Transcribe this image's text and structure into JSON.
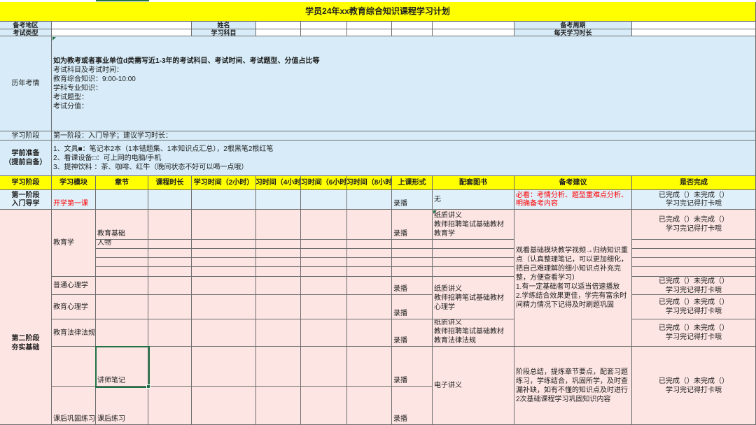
{
  "sheet": {
    "title": "学员24年xx教育综合知识课程学习计划"
  },
  "info": {
    "region_label": "备考地区",
    "name_label": "姓名",
    "period_label": "备考周期",
    "exam_type_label": "考试类型",
    "subject_label": "学习科目",
    "daily_time_label": "每天学习时长"
  },
  "history": {
    "label": "历年考情",
    "note": "如为教考或者事业单位d类需写近1-3年的考试科目、考试时间、考试题型、分值占比等",
    "details": "考试科目及考试时间：\n教育综合知识：9:00-10:00\n学科专业知识：\n考试题型：\n考试分值："
  },
  "phase_row": {
    "label": "学习阶段",
    "value": "第一阶段：入门导学；建议学习时长："
  },
  "prep": {
    "label": "学前准备\n（提前自备）",
    "items": "1、文具■：笔记本2本（1本错题集、1本知识点汇总），2根黑笔2根红笔\n2、看课设备□：可上网的电脑/手机\n3、提神饮料 ：茶、咖啡、红牛（晚间状态不好可以喝一点哦）"
  },
  "columns": [
    "学习阶段",
    "学习模块",
    "章节",
    "课程时长",
    "学习时间（2小时）",
    "习时间（4小时",
    "习时间（6小时",
    "习时间（8小时",
    "上课形式",
    "配套图书",
    "备考建议",
    "是否完成"
  ],
  "status_text": {
    "done": "已完成（）未完成（）\n学习完记得打卡哦"
  },
  "stage1": {
    "label": "第一阶段\n入门导学",
    "module": "开学第一课",
    "format": "录播",
    "book": "无",
    "advice": "必看：考情分析、题型重难点分析、\n明确备考内容"
  },
  "stage2": {
    "label": "第二阶段\n夯实基础",
    "modules": [
      "教育学",
      "普通心理学",
      "教育心理学",
      "教育法律法规",
      "课后巩固练习"
    ],
    "chapters": [
      "教育基础",
      "人物",
      "讲师笔记",
      "课后练习"
    ],
    "formats": [
      "录播",
      "录播",
      "录播",
      "录播",
      "录播",
      "录播"
    ],
    "books": [
      "纸质讲义\n教师招聘笔试基础教材\n教育学",
      "纸质讲义\n教师招聘笔试基础教材\n心理学",
      "纸质讲义\n教师招聘笔试基础教材\n教育法律法规",
      "电子讲义"
    ],
    "advice": [
      "观看基础模块教学视频→归纳知识重\n点（认真整理笔记，可以更加细化，\n把自己难理解的细小知识点补充完\n整，方便查看学习）\n1.有一定基础者可以适当倍速播放\n2.学练结合效果更佳，学完有富余时\n间精力情况下记得及时刷题巩固",
      "阶段总结，提炼章节要点，配套习题\n练习，学练结合，巩固所学，及时查\n漏补缺，如有不懂的知识点及时进行\n2次基础课程学习巩固知识内容"
    ]
  },
  "colors": {
    "title_bg": "#FFFF00",
    "header_bg": "#FFFF00",
    "info_bg": "#D7ECF8",
    "stage1_bg": "#DFF0FA",
    "stage2_bg": "#FCE5E3",
    "accent_red": "#FF0000",
    "selection_green": "#217346"
  }
}
